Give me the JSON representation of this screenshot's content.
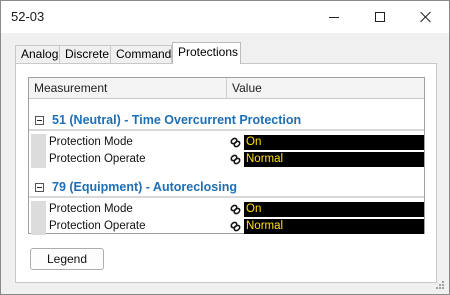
{
  "window": {
    "title": "52-03"
  },
  "tabs": [
    {
      "label": "Analog"
    },
    {
      "label": "Discrete"
    },
    {
      "label": "Commands"
    },
    {
      "label": "Protections"
    }
  ],
  "grid": {
    "columns": [
      "Measurement",
      "Value"
    ],
    "sections": [
      {
        "title": "51 (Neutral) - Time Overcurrent Protection",
        "rows": [
          {
            "measurement": "Protection Mode",
            "value": "On"
          },
          {
            "measurement": "Protection Operate",
            "value": "Normal"
          }
        ]
      },
      {
        "title": "79 (Equipment) - Autoreclosing",
        "rows": [
          {
            "measurement": "Protection Mode",
            "value": "On"
          },
          {
            "measurement": "Protection Operate",
            "value": "Normal"
          }
        ]
      }
    ]
  },
  "footer": {
    "legend_label": "Legend"
  },
  "colors": {
    "section_title": "#1e6fb5",
    "value_bg": "#000000",
    "value_text": "#ffe000"
  },
  "icons": {
    "row_icon": "link-icon",
    "expander": "collapse-icon"
  }
}
